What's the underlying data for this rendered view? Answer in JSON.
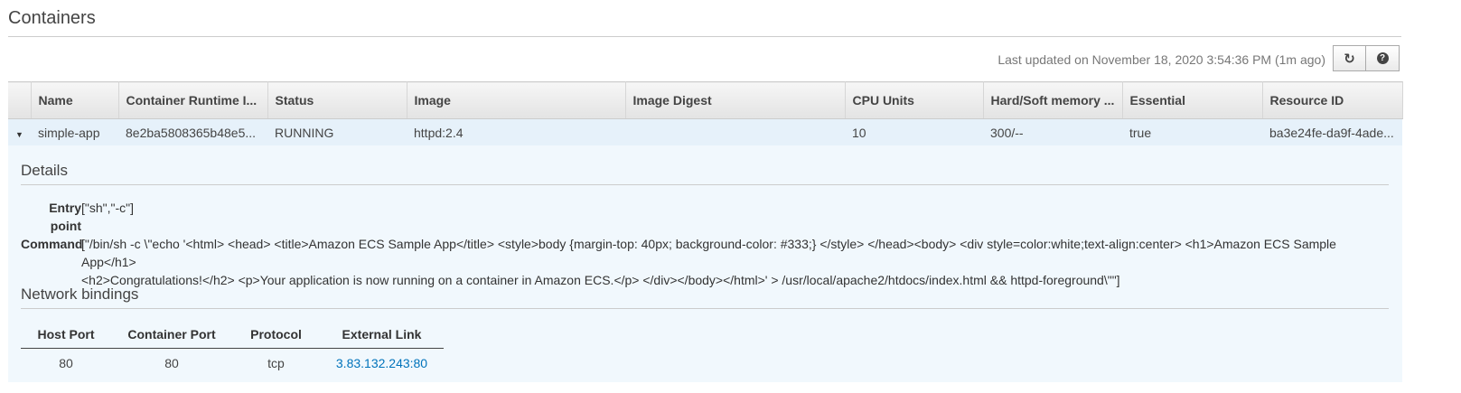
{
  "section_title": "Containers",
  "last_updated": "Last updated on November 18, 2020 3:54:36 PM (1m ago)",
  "toolbar": {
    "refresh_icon": "refresh-icon",
    "help_icon": "help-icon"
  },
  "table": {
    "columns": [
      "Name",
      "Container Runtime I...",
      "Status",
      "Image",
      "Image Digest",
      "CPU Units",
      "Hard/Soft memory ...",
      "Essential",
      "Resource ID"
    ],
    "row": {
      "name": "simple-app",
      "runtime_id": "8e2ba5808365b48e5...",
      "status": "RUNNING",
      "image": "httpd:2.4",
      "image_digest": "",
      "cpu_units": "10",
      "memory": "300/--",
      "essential": "true",
      "resource_id": "ba3e24fe-da9f-4ade..."
    }
  },
  "details": {
    "title": "Details",
    "entry_point_label_1": "Entry",
    "entry_point_label_2": "point",
    "entry_point_value": "[\"sh\",\"-c\"]",
    "command_label": "Command",
    "command_line_1": "[\"/bin/sh -c \\\"echo '<html> <head> <title>Amazon ECS Sample App</title> <style>body {margin-top: 40px; background-color: #333;} </style> </head><body> <div style=color:white;text-align:center> <h1>Amazon ECS Sample App</h1>",
    "command_line_2": "<h2>Congratulations!</h2> <p>Your application is now running on a container in Amazon ECS.</p> </div></body></html>' > /usr/local/apache2/htdocs/index.html && httpd-foreground\\\"\"]"
  },
  "network": {
    "title": "Network bindings",
    "columns": [
      "Host Port",
      "Container Port",
      "Protocol",
      "External Link"
    ],
    "row": {
      "host_port": "80",
      "container_port": "80",
      "protocol": "tcp",
      "external_link": "3.83.132.243:80"
    }
  },
  "colors": {
    "running": "#1d8102",
    "link": "#0073bb",
    "selected_row": "#e6f1fa",
    "details_bg": "#f1f8fd"
  }
}
